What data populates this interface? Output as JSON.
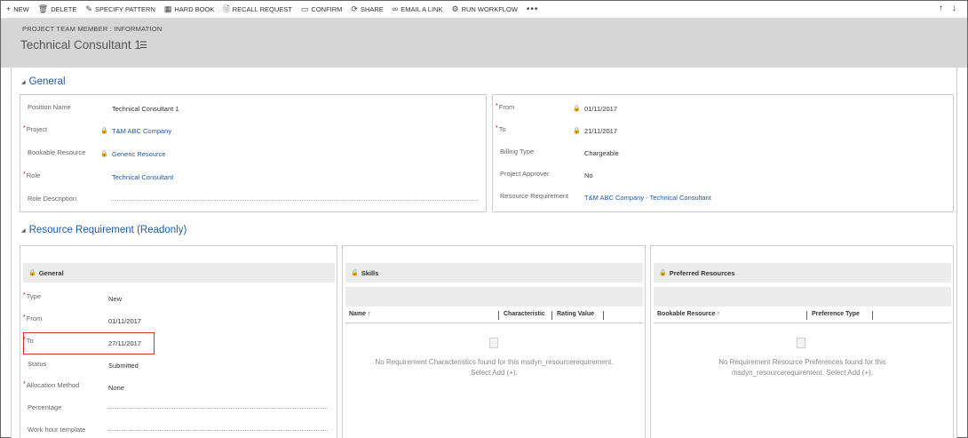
{
  "toolbar": {
    "new": "NEW",
    "delete": "DELETE",
    "specify_pattern": "SPECIFY PATTERN",
    "hard_book": "HARD BOOK",
    "recall_request": "RECALL REQUEST",
    "confirm": "CONFIRM",
    "share": "SHARE",
    "email_link": "EMAIL A LINK",
    "run_workflow": "RUN WORKFLOW",
    "more": "•••"
  },
  "header": {
    "entity": "PROJECT TEAM MEMBER : INFORMATION",
    "title": "Technical Consultant 1"
  },
  "general": {
    "title": "General",
    "position_name_label": "Position Name",
    "position_name_value": "Technical Consultant 1",
    "project_label": "Project",
    "project_value": "T&M ABC Company",
    "bookable_resource_label": "Bookable Resource",
    "bookable_resource_value": "Generic Resource",
    "role_label": "Role",
    "role_value": "Technical Consultant",
    "role_description_label": "Role Description",
    "from_label": "From",
    "from_value": "01/11/2017",
    "to_label": "To",
    "to_value": "21/11/2017",
    "billing_type_label": "Billing Type",
    "billing_type_value": "Chargeable",
    "project_approver_label": "Project Approver",
    "project_approver_value": "No",
    "resource_requirement_label": "Resource Requirement",
    "resource_requirement_value": "T&M ABC Company - Technical Consultant"
  },
  "resource_requirement": {
    "title": "Resource Requirement (Readonly)",
    "general_header": "General",
    "type_label": "Type",
    "type_value": "New",
    "from_label": "From",
    "from_value": "01/11/2017",
    "to_label": "To",
    "to_value": "27/11/2017",
    "status_label": "Status",
    "status_value": "Submitted",
    "allocation_method_label": "Allocation Method",
    "allocation_method_value": "None",
    "percentage_label": "Percentage",
    "work_hour_template_label": "Work hour template",
    "skills_header": "Skills",
    "skills_col_name": "Name ↑",
    "skills_col_characteristic": "Characteristic",
    "skills_col_rating": "Rating Value",
    "skills_empty_line1": "No Requirement Characteristics found for this msdyn_resourcerequirement.",
    "skills_empty_line2": "Select Add (+).",
    "preferred_header": "Preferred Resources",
    "preferred_col_resource": "Bookable Resource ↑",
    "preferred_col_type": "Preference Type",
    "preferred_empty_line1": "No Requirement Resource Preferences found for this",
    "preferred_empty_line2": "msdyn_resourcerequirement. Select Add (+)."
  },
  "colors": {
    "accent": "#1f5aa6",
    "required": "#cc0000",
    "highlight": "#e03030",
    "header_bg": "#d6d6d6"
  }
}
